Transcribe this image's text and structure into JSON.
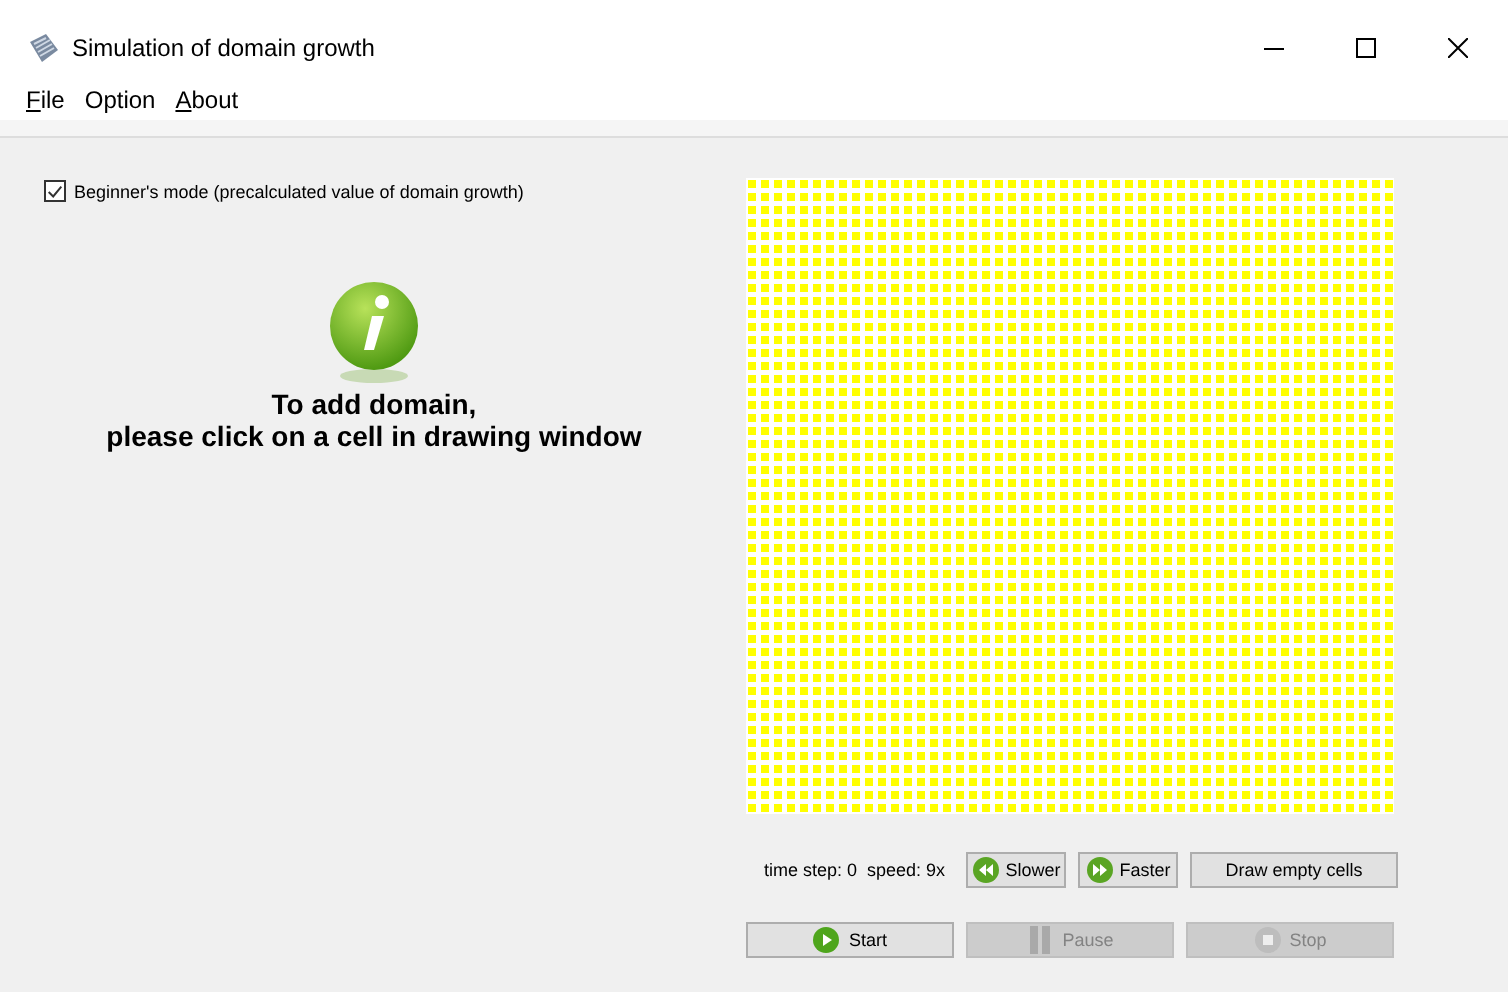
{
  "window": {
    "title": "Simulation of domain growth"
  },
  "menu": [
    {
      "label": "File",
      "underlined": true
    },
    {
      "label": "Option",
      "underlined": false
    },
    {
      "label": "About",
      "underlined": true
    }
  ],
  "beginners_mode": {
    "label": "Beginner's mode (precalculated value of domain growth)",
    "checked": true
  },
  "info": {
    "lines": [
      "To add domain,",
      "please click on a cell in drawing window"
    ]
  },
  "status": "time step: 0  speed: 9x",
  "speed_buttons": [
    {
      "label": "Slower",
      "kind": "rewind"
    },
    {
      "label": "Faster",
      "kind": "forward"
    },
    {
      "label": "Draw empty cells",
      "kind": "plain"
    }
  ],
  "controls": [
    {
      "label": "Start",
      "kind": "play",
      "disabled": false
    },
    {
      "label": "Pause",
      "kind": "pause",
      "disabled": true
    },
    {
      "label": "Stop",
      "kind": "stop",
      "disabled": true
    }
  ]
}
